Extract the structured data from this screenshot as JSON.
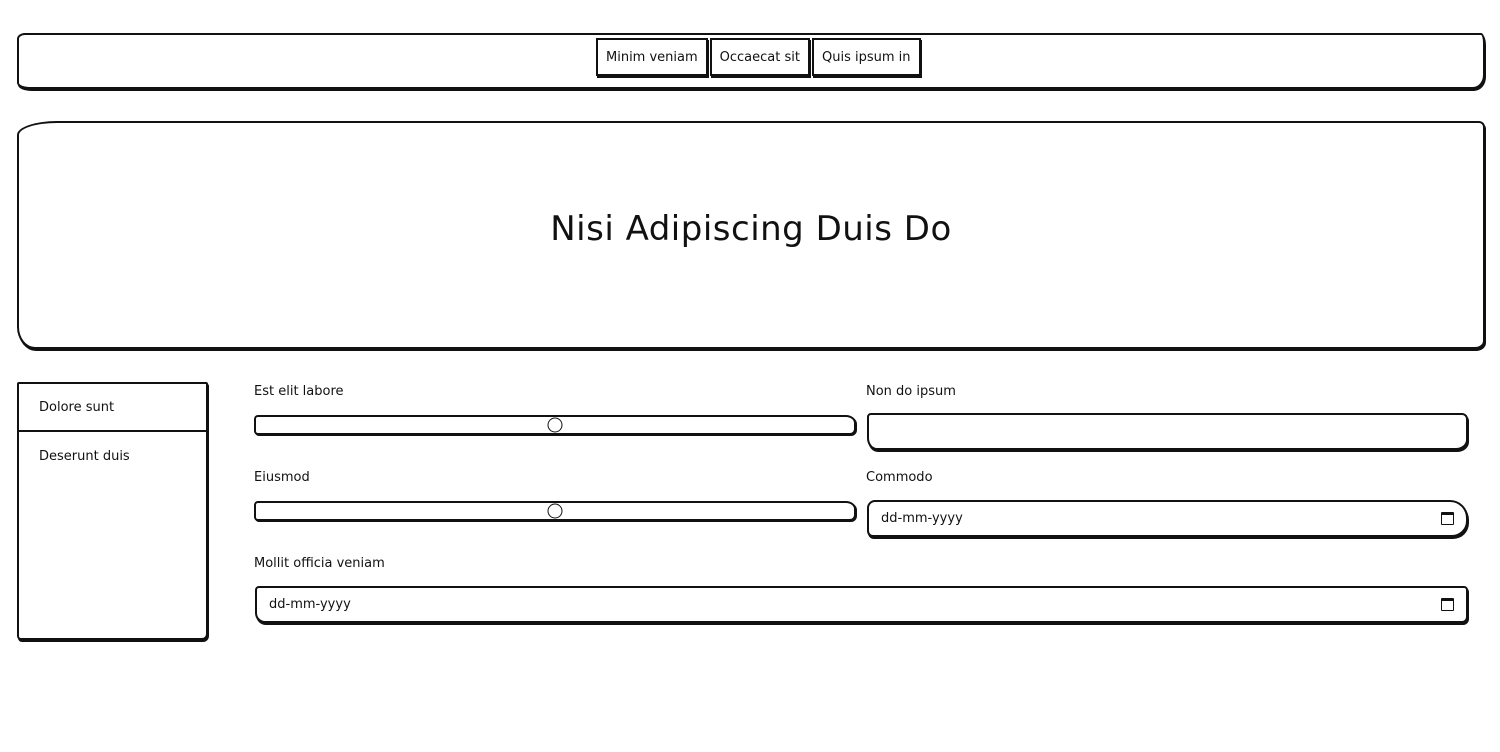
{
  "nav": {
    "links": [
      "Minim veniam",
      "Occaecat sit",
      "Quis ipsum in"
    ]
  },
  "hero": {
    "title": "Nisi Adipiscing Duis Do"
  },
  "sidebar": {
    "items": [
      "Dolore sunt",
      "Deserunt duis"
    ]
  },
  "form": {
    "slider1": {
      "label": "Est elit labore",
      "value_fraction": 0.5
    },
    "text1": {
      "label": "Non do ipsum",
      "value": "",
      "placeholder": ""
    },
    "slider2": {
      "label": "Eiusmod",
      "value_fraction": 0.5
    },
    "date1": {
      "label": "Commodo",
      "placeholder": "dd-mm-yyyy",
      "icon": "calendar-icon"
    },
    "date2": {
      "label": "Mollit officia veniam",
      "placeholder": "dd-mm-yyyy",
      "icon": "calendar-icon"
    }
  }
}
